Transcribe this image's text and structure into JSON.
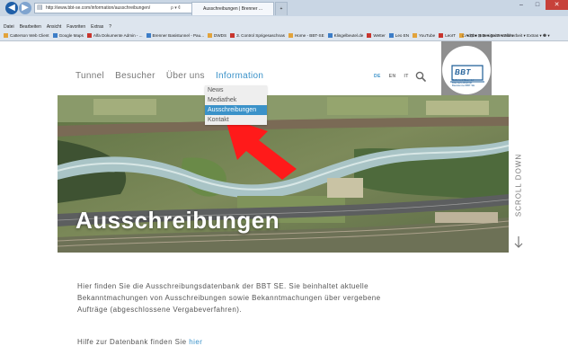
{
  "browser": {
    "address": "http://www.bbt-se.com/information/ausschreibungen/",
    "address_tools": "ρ ▾ ¢",
    "tab_title": "Ausschreibungen | Brenner ...",
    "new_tab": "+",
    "window_buttons": {
      "minimize": "–",
      "maximize": "□",
      "close": "✕"
    },
    "menu": [
      "Datei",
      "Bearbeiten",
      "Ansicht",
      "Favoriten",
      "Extras",
      "?"
    ],
    "favorites": [
      "Catterson Web Client",
      "Google Maps",
      "Alfa Dokumente Admin - ...",
      "Brenner Basistunnel - Pau...",
      "DWDS",
      "3. Control Sprigesaschnas",
      "Home - BBT-SE",
      "Klingelbeutel.de",
      "Wetter",
      "Leo EN",
      "YouTube",
      "LeoIT",
      "Adobe InDesign: Erstellen ..."
    ],
    "command_bar": "☖ ▾ ⊡ ▾ ⊡ ⊕ ▾ Seite ▾ Sicherheit ▾ Extras ▾ ❷ ▾"
  },
  "nav": {
    "items": [
      "Tunnel",
      "Besucher",
      "Über uns",
      "Information"
    ],
    "active": "Information"
  },
  "languages": {
    "de": "DE",
    "en": "EN",
    "it": "IT"
  },
  "logo": {
    "text": "BBT",
    "subtitle": "Galleria di Base del Brennero Brenner Basistunnel BBT SE"
  },
  "dropdown": {
    "items": [
      "News",
      "Mediathek",
      "Ausschreibungen",
      "Kontakt"
    ],
    "selected": "Ausschreibungen"
  },
  "hero": {
    "title": "Ausschreibungen"
  },
  "scroll": {
    "label": "SCROLL DOWN"
  },
  "content": {
    "intro": "Hier finden Sie die Ausschreibungsdatenbank der BBT SE. Sie beinhaltet aktuelle Bekanntmachungen von Ausschreibungen sowie Bekanntmachungen über vergebene Aufträge (abgeschlossene Vergabeverfahren).",
    "help_prefix": "Hilfe zur Datenbank finden Sie ",
    "help_link": "hier"
  },
  "colors": {
    "accent": "#3b92c9",
    "nav_text": "#777777",
    "logo_box": "#8f8f8f",
    "pointer_arrow": "#ff1a1a"
  }
}
